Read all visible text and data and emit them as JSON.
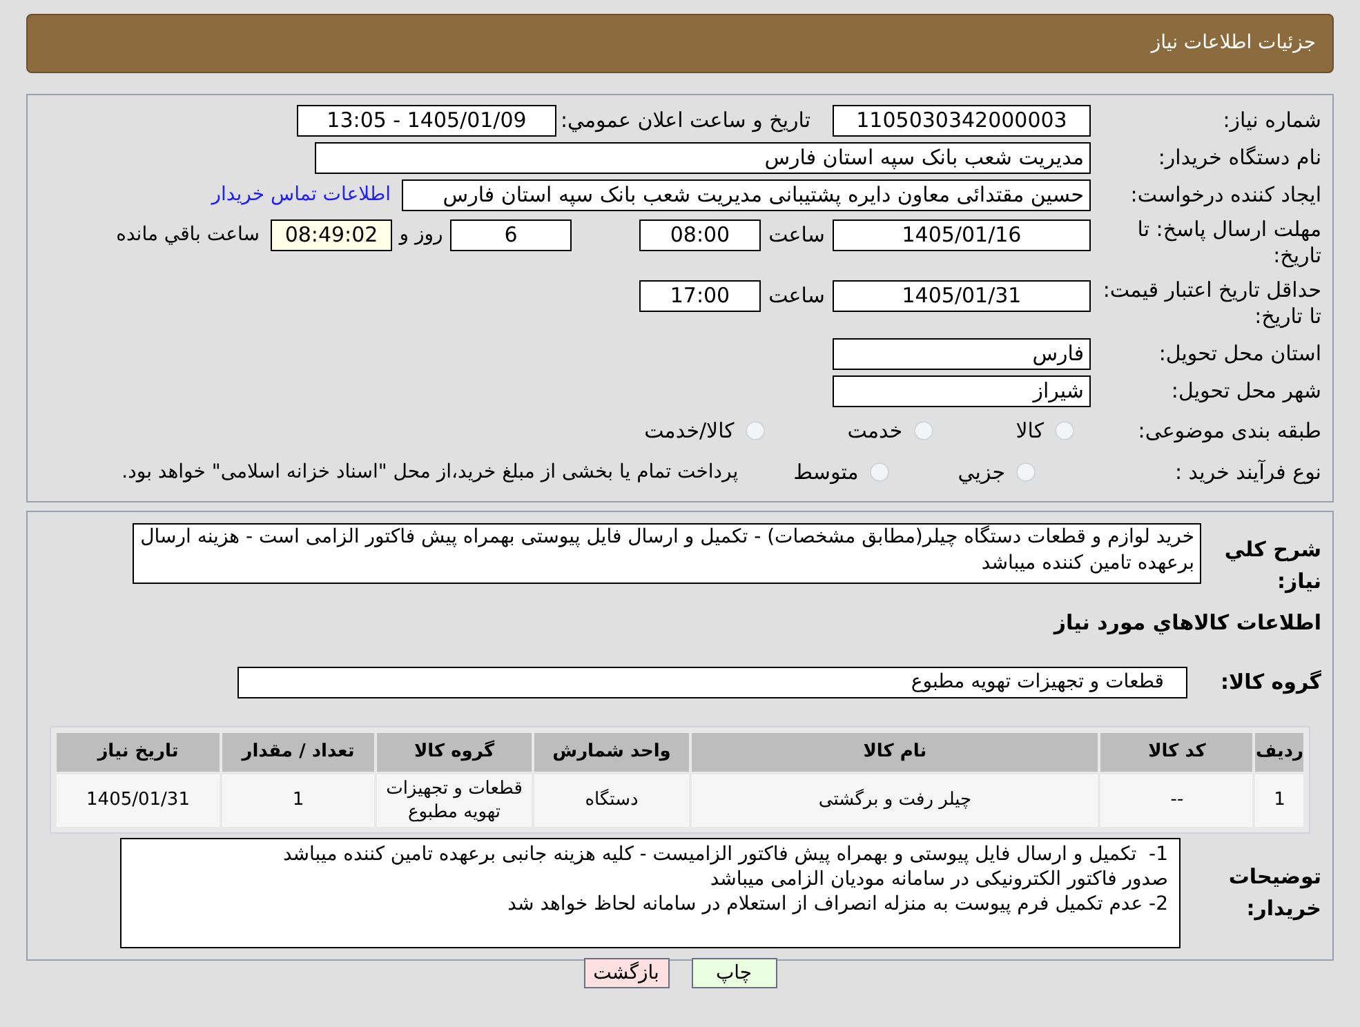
{
  "header": {
    "title": "جزئیات اطلاعات نیاز"
  },
  "need_number": {
    "label": "شماره نیاز:",
    "value": "1105030342000003"
  },
  "announce": {
    "label": "تاريخ و ساعت اعلان عمومي:",
    "value": "1405/01/09 - 13:05"
  },
  "buyer_org": {
    "label": "نام دستگاه خریدار:",
    "value": "مدیریت شعب بانک سپه استان فارس"
  },
  "requester": {
    "label": "ایجاد کننده درخواست:",
    "value": "حسین مقتدائی معاون  دایره پشتیبانی مدیریت شعب بانک سپه استان فارس",
    "link": "اطلاعات تماس خریدار"
  },
  "reply_deadline": {
    "label": "مهلت ارسال پاسخ: تا تاریخ:",
    "date": "1405/01/16",
    "time_label": "ساعت",
    "time": "08:00",
    "days": "6",
    "days_label": "روز و",
    "remaining": "08:49:02",
    "remaining_label": "ساعت باقي مانده"
  },
  "price_validity": {
    "label": "حداقل تاریخ اعتبار قیمت: تا تاریخ:",
    "date": "1405/01/31",
    "time_label": "ساعت",
    "time": "17:00"
  },
  "province": {
    "label": "استان محل تحویل:",
    "value": "فارس"
  },
  "city": {
    "label": "شهر محل تحویل:",
    "value": "شیراز"
  },
  "category": {
    "label": "طبقه بندی موضوعی:",
    "options": [
      {
        "label": "کالا",
        "selected": false
      },
      {
        "label": "خدمت",
        "selected": false
      },
      {
        "label": "کالا/خدمت",
        "selected": false
      }
    ]
  },
  "purchase_type": {
    "label": "نوع فرآیند خرید :",
    "options": [
      {
        "label": "جزيي",
        "selected": false
      },
      {
        "label": "متوسط",
        "selected": false
      }
    ],
    "note": "پرداخت تمام یا بخشی از مبلغ خرید،از محل \"اسناد خزانه اسلامی\" خواهد بود."
  },
  "description": {
    "label": "شرح کلي نياز:",
    "value": "خرید لوازم و قطعات دستگاه چیلر(مطابق مشخصات) - تکمیل و ارسال فایل پیوستی بهمراه پیش فاکتور الزامی است - هزینه ارسال برعهده تامین کننده میباشد"
  },
  "goods_title": "اطلاعات کالاهاي مورد نياز",
  "goods_group": {
    "label": "گروه کالا:",
    "value": "قطعات و تجهیزات تهویه مطبوع"
  },
  "table": {
    "columns": [
      "ردیف",
      "کد کالا",
      "نام کالا",
      "واحد شمارش",
      "گروه کالا",
      "تعداد / مقدار",
      "تاریخ نیاز"
    ],
    "rows": [
      [
        "1",
        "--",
        "چیلر رفت و برگشتی",
        "دستگاه",
        "قطعات و تجهیزات تهویه مطبوع",
        "1",
        "1405/01/31"
      ]
    ]
  },
  "buyer_notes": {
    "label": "توضیحات خریدار:",
    "lines": [
      "1-  تکمیل و ارسال فایل پیوستی و بهمراه پیش فاکتور الزامیست - کلیه هزینه جانبی برعهده تامین کننده میباشد",
      "صدور فاکتور الکترونیکی در سامانه مودیان الزامی میباشد",
      "2- عدم تکمیل فرم پیوست به منزله انصراف از استعلام در سامانه لحاظ خواهد شد"
    ]
  },
  "buttons": [
    {
      "label": "چاپ",
      "kind": "print"
    },
    {
      "label": "بازگشت",
      "kind": "back"
    }
  ]
}
